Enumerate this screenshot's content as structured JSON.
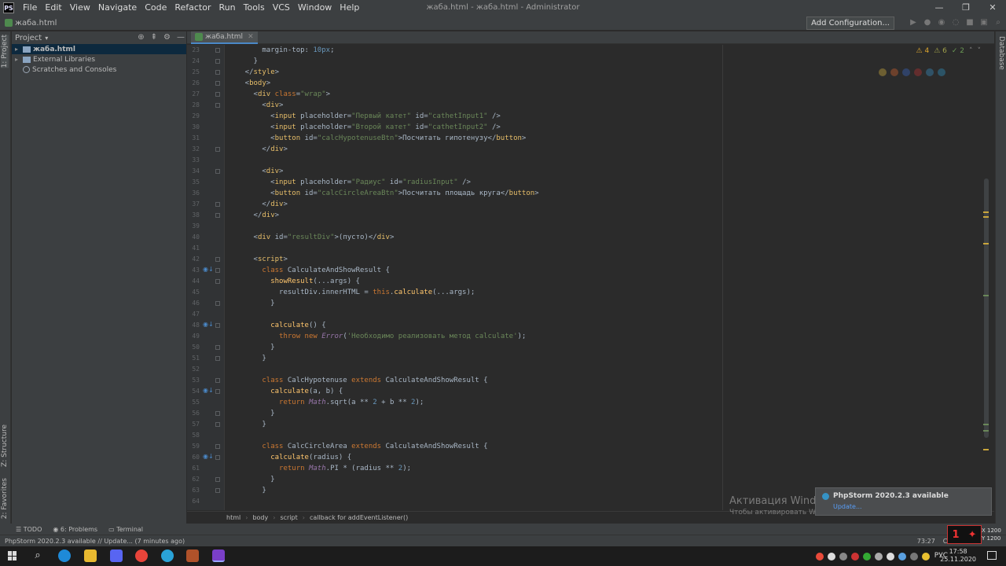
{
  "window": {
    "title": "жаба.html - жаба.html - Administrator",
    "menu": [
      "File",
      "Edit",
      "View",
      "Navigate",
      "Code",
      "Refactor",
      "Run",
      "Tools",
      "VCS",
      "Window",
      "Help"
    ],
    "logo": "PS"
  },
  "navbar": {
    "file": "жаба.html",
    "add_config": "Add Configuration..."
  },
  "left_stripe": {
    "project": "1: Project",
    "structure": "Z: Structure",
    "favorites": "2: Favorites"
  },
  "right_stripe": {
    "database": "Database"
  },
  "project_panel": {
    "title": "Project",
    "items": [
      {
        "label": "жаба.html",
        "selected": true
      },
      {
        "label": "External Libraries",
        "selected": false
      },
      {
        "label": "Scratches and Consoles",
        "selected": false
      }
    ]
  },
  "editor_tab": {
    "label": "жаба.html"
  },
  "inspection": {
    "warnings": "4",
    "weak_warnings": "6",
    "typos": "2"
  },
  "code": {
    "line_numbers": [
      "23",
      "24",
      "25",
      "26",
      "27",
      "28",
      "29",
      "30",
      "31",
      "32",
      "33",
      "34",
      "35",
      "36",
      "37",
      "38",
      "39",
      "40",
      "41",
      "42",
      "43",
      "44",
      "45",
      "46",
      "47",
      "48",
      "49",
      "50",
      "51",
      "52",
      "53",
      "54",
      "55",
      "56",
      "57",
      "58",
      "59",
      "60",
      "61",
      "62",
      "63",
      "64"
    ],
    "lines": [
      "        margin-top: 10px;",
      "      }",
      "    </style>",
      "    <body>",
      "      <div class=\"wrap\">",
      "        <div>",
      "          <input placeholder=\"Первый катет\" id=\"cathetInput1\" />",
      "          <input placeholder=\"Второй катет\" id=\"cathetInput2\" />",
      "          <button id=\"calcHypotenuseBtn\">Посчитать гипотенузу</button>",
      "        </div>",
      "",
      "        <div>",
      "          <input placeholder=\"Радиус\" id=\"radiusInput\" />",
      "          <button id=\"calcCircleAreaBtn\">Посчитать площадь круга</button>",
      "        </div>",
      "      </div>",
      "",
      "      <div id=\"resultDiv\">(пусто)</div>",
      "",
      "      <script>",
      "        class CalculateAndShowResult {",
      "          showResult(...args) {",
      "            resultDiv.innerHTML = this.calculate(...args);",
      "          }",
      "",
      "          calculate() {",
      "            throw new Error('Необходимо реализовать метод calculate');",
      "          }",
      "        }",
      "",
      "        class CalcHypotenuse extends CalculateAndShowResult {",
      "          calculate(a, b) {",
      "            return Math.sqrt(a ** 2 + b ** 2);",
      "          }",
      "        }",
      "",
      "        class CalcCircleArea extends CalculateAndShowResult {",
      "          calculate(radius) {",
      "            return Math.PI * (radius ** 2);",
      "          }",
      "        }",
      ""
    ]
  },
  "breadcrumbs": [
    "html",
    "body",
    "script",
    "callback for addEventListener()"
  ],
  "notification": {
    "title": "PhpStorm 2020.2.3 available",
    "link": "Update..."
  },
  "activation": {
    "line1": "Активация Windows",
    "line2": "Чтобы активировать Windows, перейдите в раздел \"Параметры\"."
  },
  "tool_tabs": [
    "TODO",
    "6: Problems",
    "Terminal"
  ],
  "statusbar": {
    "message": "PhpStorm 2020.2.3 available // Update... (7 minutes ago)",
    "position": "73:27",
    "line_sep": "CRLF"
  },
  "overlay": {
    "x": "X 1200",
    "y": "Y 1200"
  },
  "taskbar": {
    "lang": "РУС",
    "time": "17:58",
    "date": "25.11.2020"
  },
  "colors": {
    "keyword": "#cc7832",
    "tag": "#e8bf6a",
    "string": "#6a8759",
    "number": "#6897bb",
    "func": "#ffc66d",
    "text": "#a9b7c6"
  }
}
